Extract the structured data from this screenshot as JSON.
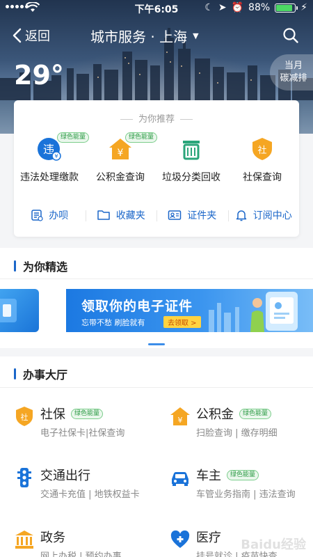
{
  "status_bar": {
    "time": "下午6:05",
    "battery": "88%",
    "battery_level": 0.88
  },
  "nav": {
    "back_label": "返回",
    "title": "城市服务 · 上海"
  },
  "weather": {
    "temperature": "29°"
  },
  "carbon_badge": {
    "line1": "当月",
    "line2": "碳减排"
  },
  "recommend": {
    "header": "为你推荐",
    "services": [
      {
        "label": "违法处理缴款",
        "tag": "绿色能量",
        "icon": "traffic-violation-icon"
      },
      {
        "label": "公积金查询",
        "tag": "绿色能量",
        "icon": "housing-fund-icon"
      },
      {
        "label": "垃圾分类回收",
        "tag": "",
        "icon": "recycle-icon"
      },
      {
        "label": "社保查询",
        "tag": "",
        "icon": "social-security-icon"
      }
    ],
    "tools": [
      {
        "label": "办呗",
        "icon": "task-icon"
      },
      {
        "label": "收藏夹",
        "icon": "folder-icon"
      },
      {
        "label": "证件夹",
        "icon": "id-card-icon"
      },
      {
        "label": "订阅中心",
        "icon": "bell-icon"
      }
    ]
  },
  "featured": {
    "title": "为你精选",
    "banner": {
      "title": "领取你的电子证件",
      "subtitle": "忘带不愁 刷脸就有",
      "cta": "去领取 >"
    }
  },
  "hall": {
    "title": "办事大厅",
    "items": [
      {
        "name": "社保",
        "tag": "绿色能量",
        "desc": "电子社保卡|社保查询",
        "icon": "social-security-icon"
      },
      {
        "name": "公积金",
        "tag": "绿色能量",
        "desc": "扫脸查询 | 缴存明细",
        "icon": "housing-fund-icon"
      },
      {
        "name": "交通出行",
        "tag": "",
        "desc": "交通卡充值 | 地铁权益卡",
        "icon": "traffic-light-icon"
      },
      {
        "name": "车主",
        "tag": "绿色能量",
        "desc": "车管业务指南 | 违法查询",
        "icon": "car-icon"
      },
      {
        "name": "政务",
        "tag": "",
        "desc": "网上办税 | 预约办事",
        "icon": "government-icon"
      },
      {
        "name": "医疗",
        "tag": "",
        "desc": "挂号就诊 | 疫苗快查",
        "icon": "medical-icon"
      }
    ]
  },
  "watermark": "Baidu经验",
  "colors": {
    "accent": "#1a66c9",
    "orange": "#f5a623",
    "green_tag": "#2d9b46"
  }
}
